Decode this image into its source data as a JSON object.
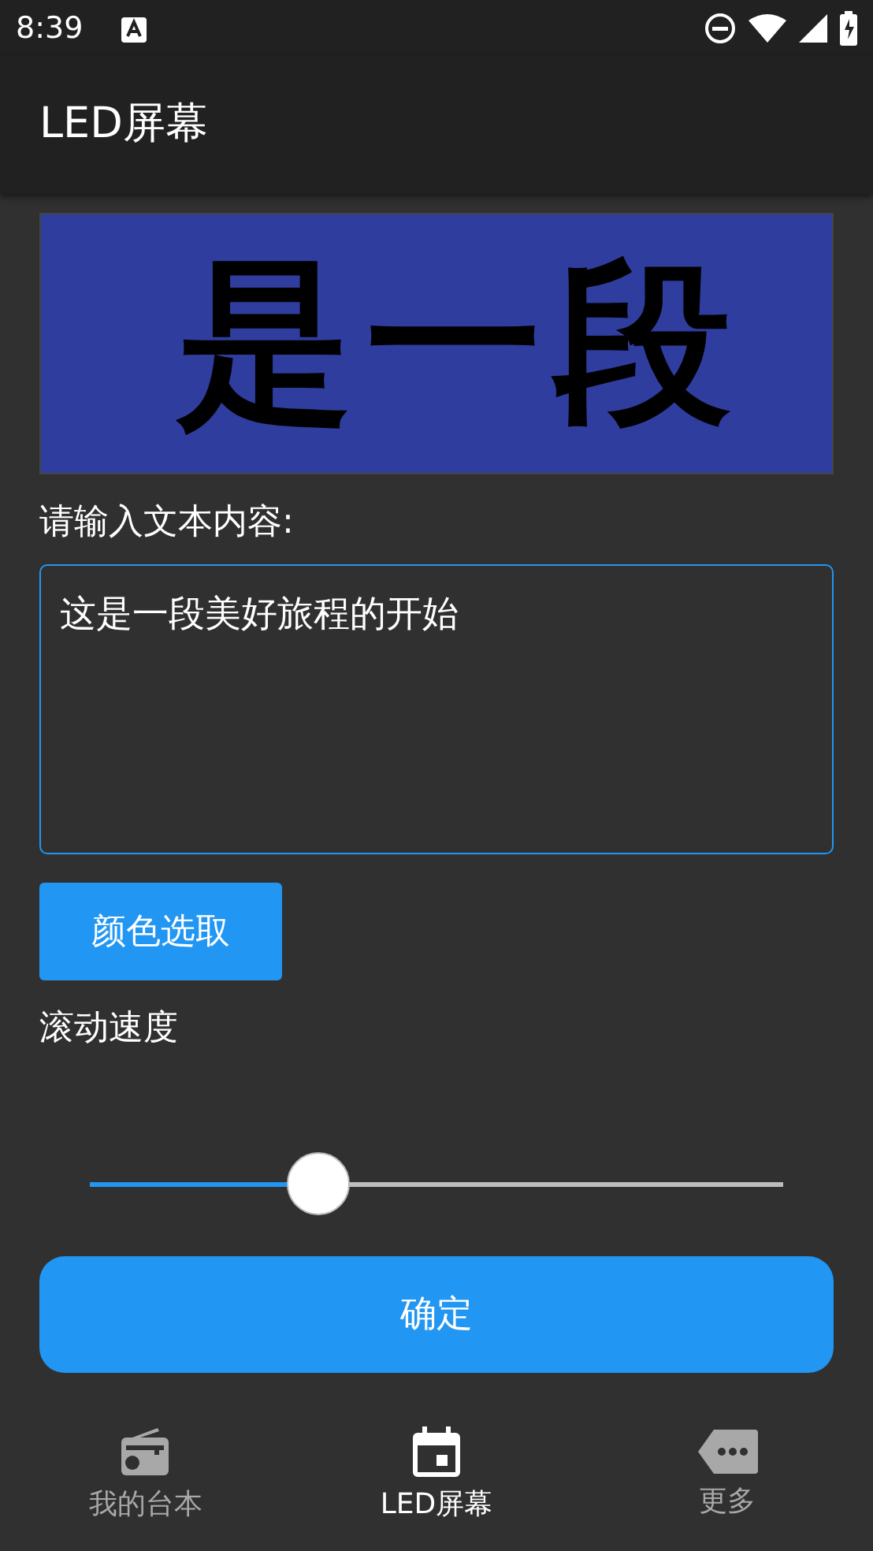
{
  "status_bar": {
    "time": "8:39"
  },
  "app_bar": {
    "title": "LED屏幕"
  },
  "led_display": {
    "text": "是一段",
    "color": "#000000"
  },
  "input_label": "请输入文本内容:",
  "text_input": {
    "value": "这是一段美好旅程的开始"
  },
  "color_button": "颜色选取",
  "speed_label": "滚动速度",
  "speed_slider": {
    "level": 0.33
  },
  "confirm_button": "确定",
  "bottom_nav": [
    {
      "kind": "radio",
      "label": "我的台本",
      "selected": false
    },
    {
      "kind": "calendar",
      "label": "LED屏幕",
      "selected": true
    },
    {
      "kind": "more",
      "label": "更多",
      "selected": false
    }
  ]
}
